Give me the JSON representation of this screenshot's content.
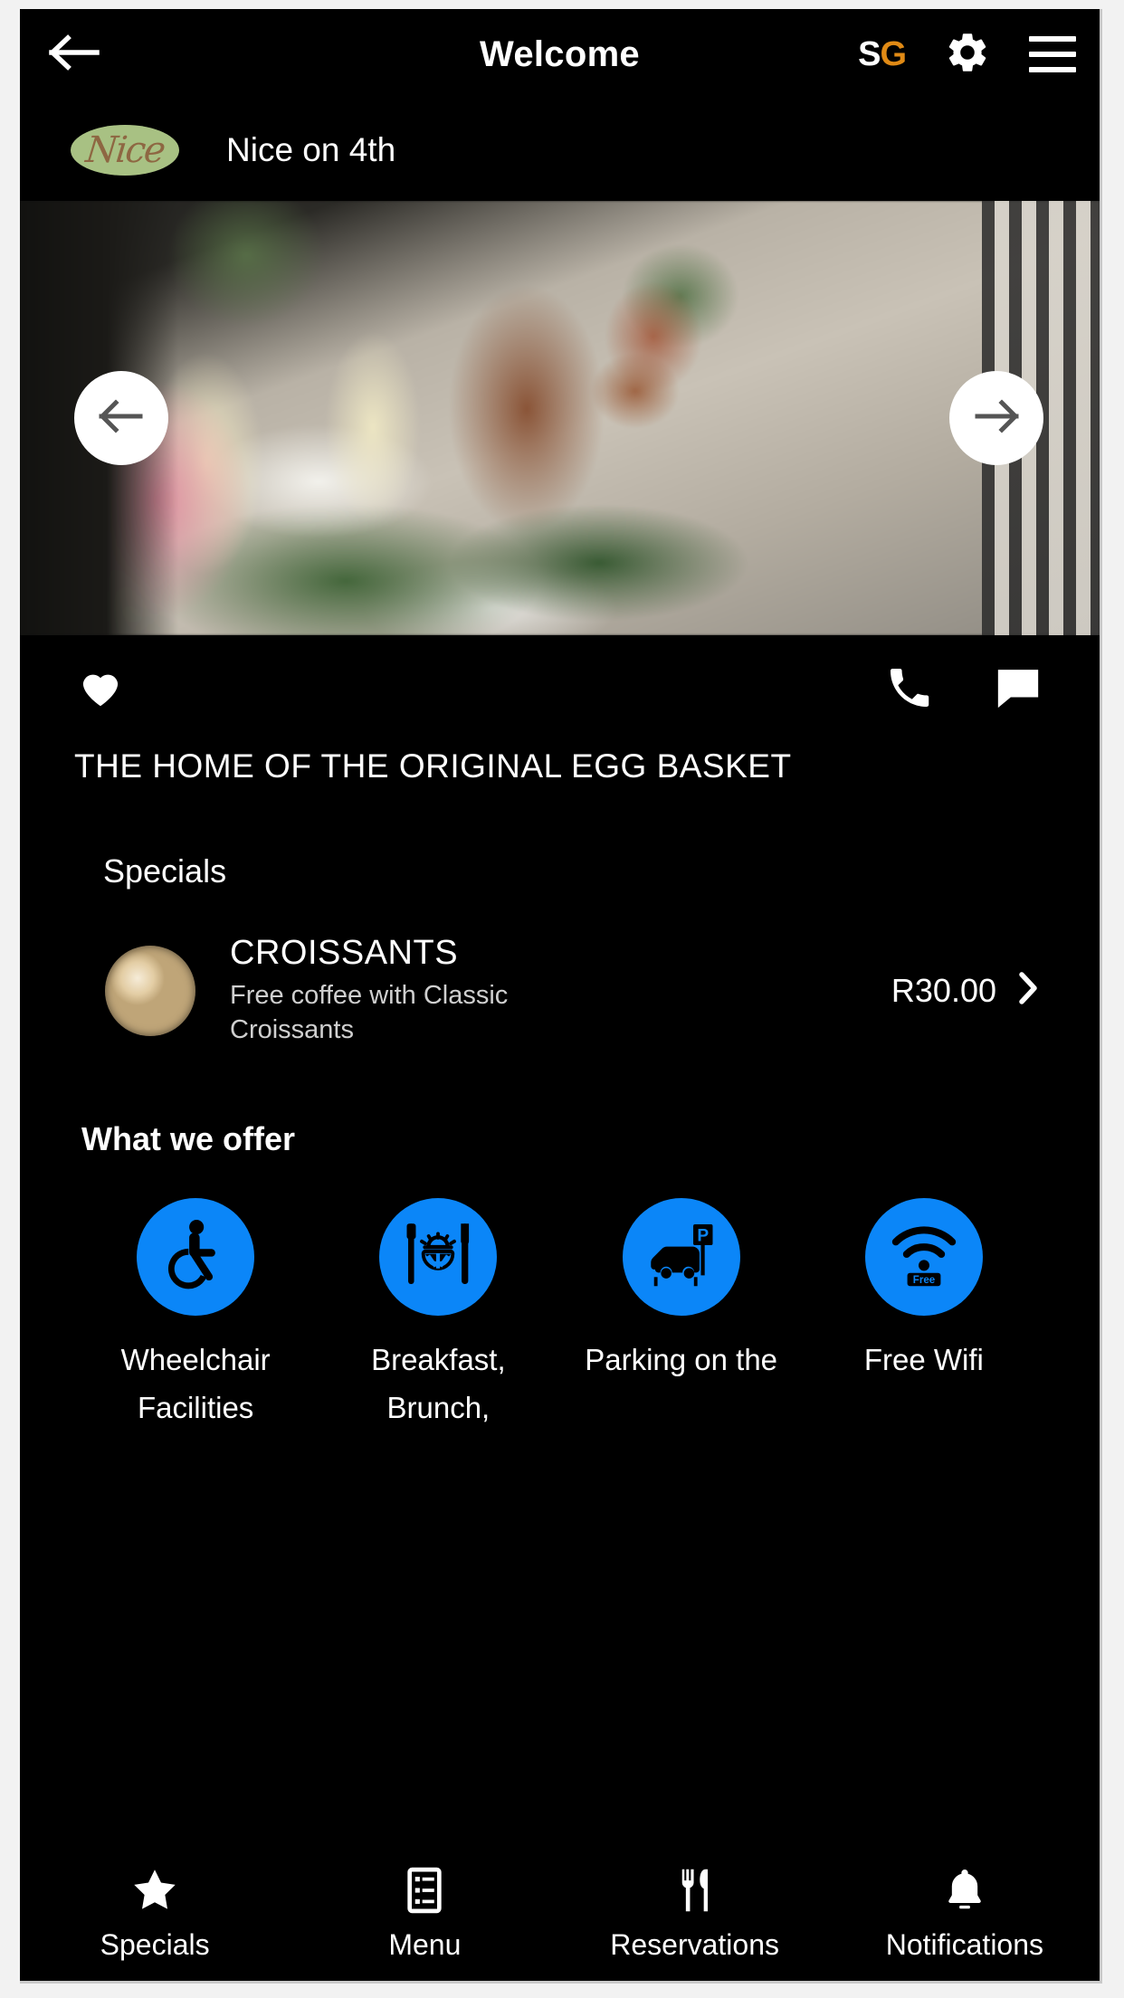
{
  "header": {
    "title": "Welcome",
    "back_icon": "arrow-left-icon",
    "brand_initials": {
      "first": "S",
      "second": "G"
    },
    "settings_icon": "gear-icon",
    "menu_icon": "hamburger-menu-icon"
  },
  "venue": {
    "logo_text": "Nice",
    "name": "Nice on 4th",
    "logo_bg_color": "#a8c183",
    "logo_text_color": "#8a5a3a"
  },
  "carousel": {
    "prev_label": "Previous image",
    "next_label": "Next image",
    "prev_icon": "arrow-left-icon",
    "next_icon": "arrow-right-icon",
    "image_alt": "Champagne glasses on an outdoor restaurant table with greenery and flowers"
  },
  "actions": {
    "favorite_icon": "heart-icon",
    "phone_icon": "phone-icon",
    "chat_icon": "chat-bubble-icon"
  },
  "tagline": "THE HOME OF THE ORIGINAL EGG BASKET",
  "specials": {
    "heading": "Specials",
    "items": [
      {
        "title": "CROISSANTS",
        "description": "Free coffee with Classic Croissants",
        "price": "R30.00",
        "chevron_icon": "chevron-right-icon",
        "thumb_alt": "Cappuccino and croissant"
      }
    ]
  },
  "offers": {
    "heading": "What we offer",
    "accent_color": "#0b86f8",
    "items": [
      {
        "label": "Wheelchair Facilities",
        "icon": "wheelchair-icon"
      },
      {
        "label": "Breakfast, Brunch,",
        "icon": "breakfast-icon"
      },
      {
        "label": "Parking on the",
        "icon": "parking-icon"
      },
      {
        "label": "Free Wifi",
        "icon": "wifi-icon",
        "badge": "Free"
      }
    ]
  },
  "bottom_nav": {
    "items": [
      {
        "label": "Specials",
        "icon": "star-icon"
      },
      {
        "label": "Menu",
        "icon": "list-icon"
      },
      {
        "label": "Reservations",
        "icon": "restaurant-icon"
      },
      {
        "label": "Notifications",
        "icon": "bell-icon"
      }
    ]
  }
}
